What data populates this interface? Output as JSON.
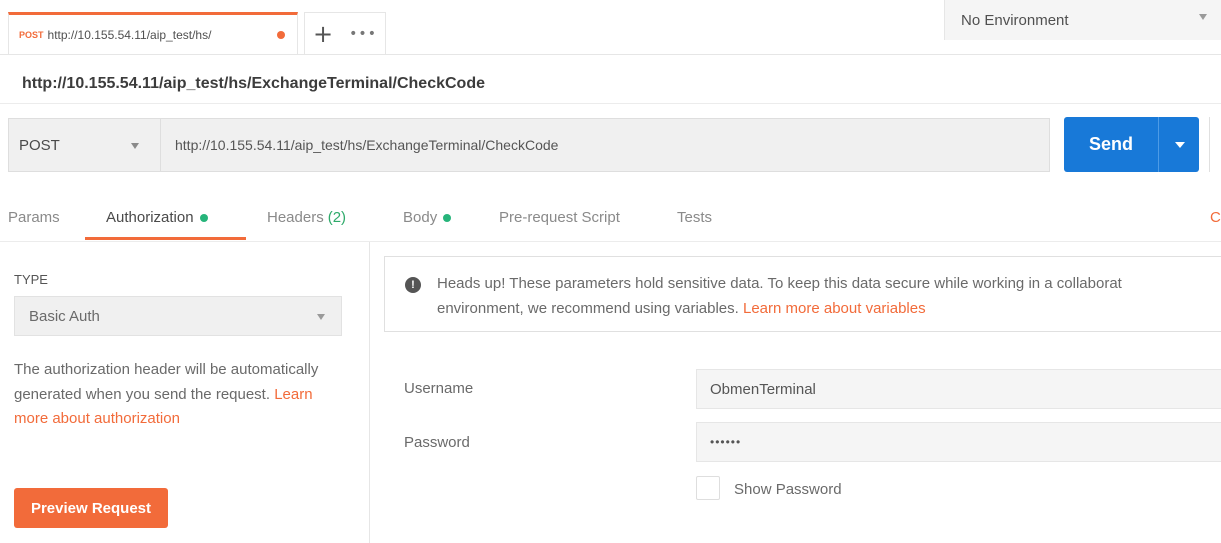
{
  "tabs": {
    "active": {
      "method": "POST",
      "title": "http://10.155.54.11/aip_test/hs/"
    },
    "new_tab_icon": "plus-icon",
    "more_icon": "more-icon",
    "more_label": "•••",
    "plus_label": "+"
  },
  "environment": {
    "selected": "No Environment"
  },
  "request": {
    "title": "http://10.155.54.11/aip_test/hs/ExchangeTerminal/CheckCode",
    "method": "POST",
    "url": "http://10.155.54.11/aip_test/hs/ExchangeTerminal/CheckCode",
    "send_label": "Send"
  },
  "subtabs": {
    "params": "Params",
    "authorization": "Authorization",
    "headers": "Headers",
    "headers_count": "(2)",
    "body": "Body",
    "prerequest": "Pre-request Script",
    "tests": "Tests",
    "cookies_edge": "C"
  },
  "auth": {
    "type_label": "TYPE",
    "type_selected": "Basic Auth",
    "description": "The authorization header will be automatically generated when you send the request.",
    "description_link": "Learn more about authorization",
    "preview_label": "Preview Request"
  },
  "notice": {
    "line1": "Heads up! These parameters hold sensitive data. To keep this data secure while working in a collaborat",
    "line2": "environment, we recommend using variables.",
    "link": "Learn more about variables"
  },
  "fields": {
    "username_label": "Username",
    "username_value": "ObmenTerminal",
    "password_label": "Password",
    "password_value": "••••••",
    "show_password_label": "Show Password"
  },
  "colors": {
    "accent": "#f26b3a",
    "send_blue": "#1879d8",
    "status_green": "#26b47a"
  }
}
